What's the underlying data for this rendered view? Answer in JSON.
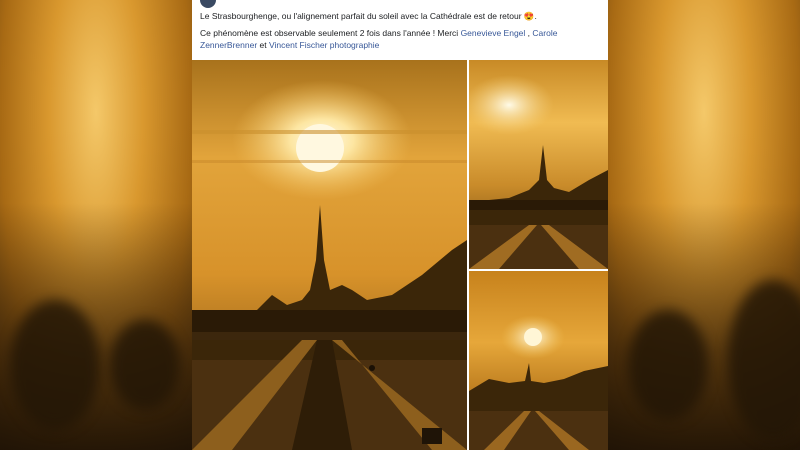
{
  "post": {
    "line1": "Le Strasbourghenge, ou l'alignement parfait du soleil avec la Cathédrale est de retour",
    "emoji": "😍",
    "line2_prefix": "Ce phénomène est observable seulement 2 fois dans l'année ! Merci ",
    "mentions": [
      "Genevieve Engel",
      "Carole ZennerBrenner",
      "Vincent Fischer photographie"
    ],
    "separator_1": " , ",
    "separator_2": " et "
  },
  "colors": {
    "mention": "#385898",
    "sky_light": "#f7d37a",
    "sky_dark": "#8a5a12",
    "sun": "#fff6d6",
    "silhouette": "#2a1a06"
  }
}
